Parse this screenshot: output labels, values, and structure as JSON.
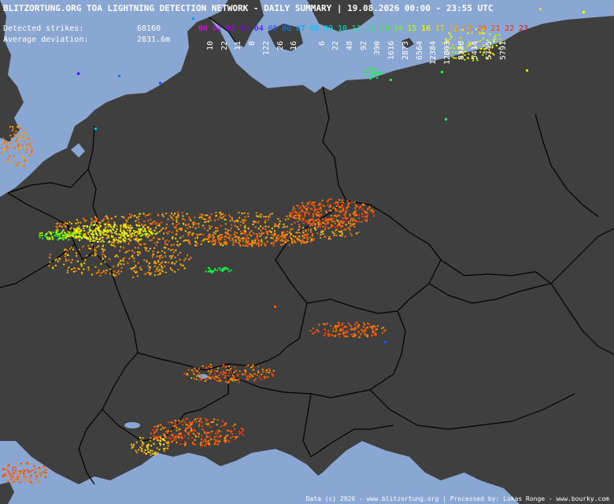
{
  "title": "BLITZORTUNG.ORG TOA LIGHTNING DETECTION NETWORK - DAILY SUMMARY | 19.08.2026 00:00 - 23:55 UTC",
  "stats": {
    "strikes_label": "Detected strikes:",
    "strikes_value": "68160",
    "deviation_label": "Average deviation:",
    "deviation_value": "2831.6m"
  },
  "hour_labels": [
    "00",
    "01",
    "02",
    "03",
    "04",
    "05",
    "06",
    "07",
    "08",
    "09",
    "10",
    "11",
    "12",
    "13",
    "14",
    "15",
    "16",
    "17",
    "18",
    "19",
    "20",
    "21",
    "22",
    "23"
  ],
  "hour_colors": [
    "#ff00ff",
    "#d400ff",
    "#a800ff",
    "#7a00ff",
    "#4c00ff",
    "#1f4fff",
    "#0080ff",
    "#00a0ff",
    "#00c0ff",
    "#00d8f0",
    "#00e8c0",
    "#00f090",
    "#00ff60",
    "#20ff20",
    "#70ff00",
    "#c0ff00",
    "#ffff00",
    "#ffd000",
    "#ffa000",
    "#ff8000",
    "#ff6000",
    "#ff4000",
    "#ff2000",
    "#ff0000"
  ],
  "strike_counts": [
    "10",
    "22",
    "11",
    "8",
    "122",
    "26",
    "16",
    "",
    "6",
    "22",
    "48",
    "92",
    "390",
    "1616",
    "2873",
    "6564",
    "12384",
    "12893",
    "8346",
    "5414",
    "5745",
    "5791",
    "",
    ""
  ],
  "footer": "Data (c) 2026 - www.blitzortung.org | Processed by: Lukas Ronge - www.bourky.com",
  "map_colors": {
    "land": "#3f3f3f",
    "water": "#8aa6d2",
    "borders": "#000000"
  }
}
